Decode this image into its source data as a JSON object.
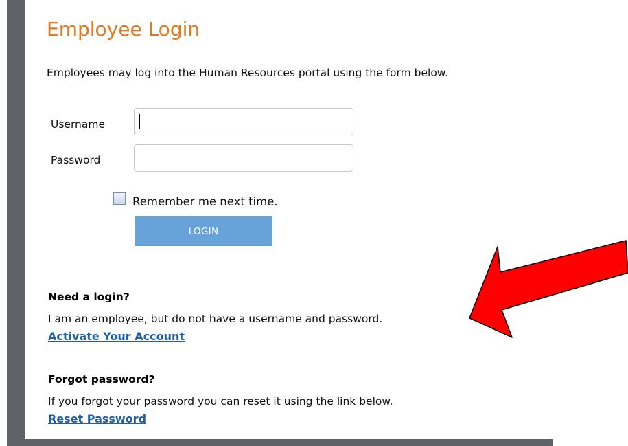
{
  "page": {
    "title": "Employee Login",
    "intro": "Employees may log into the Human Resources portal using the form below."
  },
  "form": {
    "username_label": "Username",
    "username_value": "",
    "password_label": "Password",
    "password_value": "",
    "remember_label": "Remember me next time.",
    "remember_checked": false,
    "login_label": "LOGIN"
  },
  "need_login": {
    "heading": "Need a login?",
    "text": "I am an employee, but do not have a username and password.",
    "link": "Activate Your Account"
  },
  "forgot_password": {
    "heading": "Forgot password?",
    "text": "If you forgot your password you can reset it using the link below.",
    "link": "Reset Password"
  },
  "annotation": {
    "icon": "red-arrow-icon",
    "color": "#ff0000"
  },
  "colors": {
    "title": "#e07a22",
    "button": "#67a3d9",
    "link": "#1f5fa6",
    "frame": "#5f6367"
  }
}
